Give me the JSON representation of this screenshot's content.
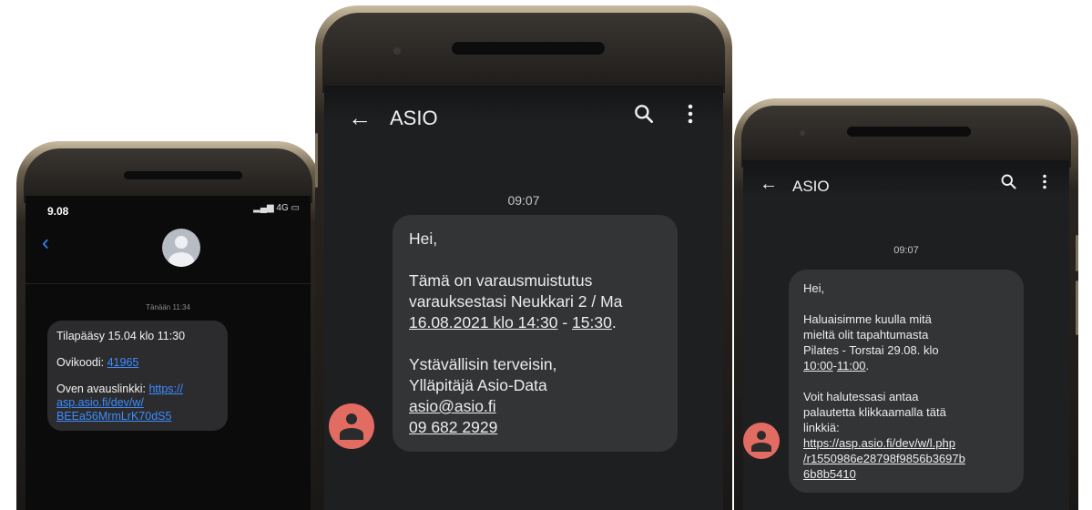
{
  "phone_left": {
    "status_time": "9.08",
    "status_signal": "4G",
    "timestamp": "Tänään 11:34",
    "message": {
      "line1": "Tilapääsy 15.04 klo 11:30",
      "code_label": "Ovikoodi: ",
      "code_value": "41965",
      "link_label": "Oven avauslinkki: ",
      "link_part1": "https://",
      "link_part2": "asp.asio.fi/dev/w/",
      "link_part3": "BEEa56MrmLrK70dS5"
    },
    "icons": {
      "back": "chevron-left-icon",
      "avatar": "contact-avatar-icon"
    }
  },
  "phone_center": {
    "title": "ASIO",
    "timestamp": "09:07",
    "message": {
      "greeting": "Hei,",
      "line1": "Tämä on varausmuistutus",
      "line2": "varauksestasi Neukkari 2 / Ma",
      "date": "16.08.2021 klo 14:30",
      "sep": " - ",
      "end": "15:30",
      "dot": ".",
      "regards": "Ystävällisin terveisin,",
      "sender": "Ylläpitäjä Asio-Data",
      "email": "asio@asio.fi",
      "phone": "09 682 2929"
    },
    "icons": {
      "back": "arrow-left-icon",
      "search": "search-icon",
      "more": "more-vert-icon",
      "avatar": "contact-avatar-icon"
    },
    "accent": "#e26b62"
  },
  "phone_right": {
    "title": "ASIO",
    "timestamp": "09:07",
    "message": {
      "greeting": "Hei,",
      "l1": "Haluaisimme kuulla mitä",
      "l2": "mieltä olit tapahtumasta",
      "l3": "Pilates - Torstai 29.08. klo",
      "t_start": "10:00",
      "t_sep": "-",
      "t_end": "11:00",
      "t_dot": ".",
      "l4": "Voit halutessasi antaa",
      "l5": "palautetta klikkaamalla tätä",
      "l6": "linkkiä:",
      "url1": "https://asp.asio.fi/dev/w/l.php",
      "url2": "/r1550986e28798f9856b3697b",
      "url3": "6b8b5410"
    },
    "icons": {
      "back": "arrow-left-icon",
      "search": "search-icon",
      "more": "more-vert-icon",
      "avatar": "contact-avatar-icon"
    }
  }
}
